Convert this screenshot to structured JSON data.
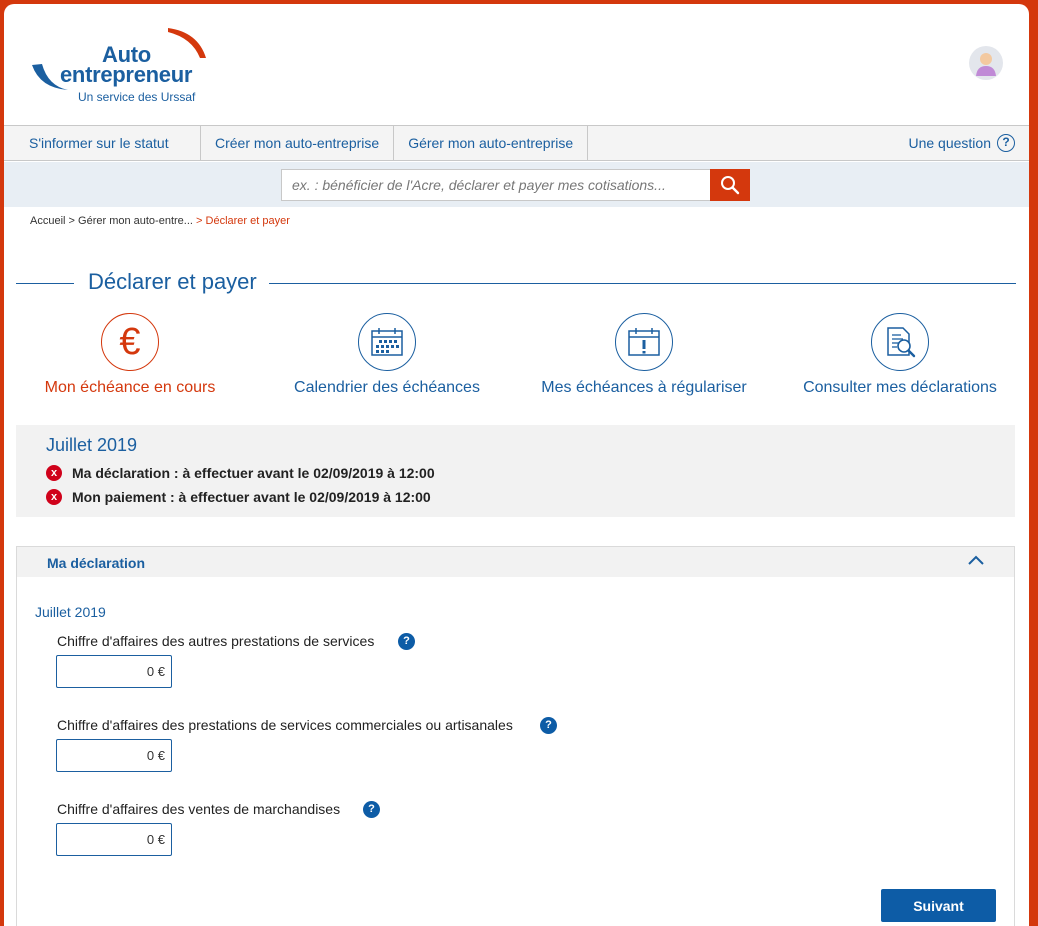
{
  "colors": {
    "brand_blue": "#1b5fa0",
    "accent_red": "#d4380d",
    "error_red": "#d0021b",
    "button_blue": "#0d5ca6"
  },
  "logo": {
    "line1": "Auto",
    "line2": "entrepreneur",
    "sub": "Un service des Urssaf"
  },
  "nav": {
    "items": [
      {
        "label": "S'informer sur le statut"
      },
      {
        "label": "Créer mon auto-entreprise"
      },
      {
        "label": "Gérer mon auto-entreprise"
      }
    ],
    "question_label": "Une question",
    "question_icon": "?"
  },
  "search": {
    "placeholder": "ex. : bénéficier de l'Acre, déclarer et payer mes cotisations..."
  },
  "breadcrumb": {
    "home": "Accueil",
    "sep1": " > ",
    "parent": "Gérer mon auto-entre...",
    "sep2": " > ",
    "current": "Déclarer et payer"
  },
  "page_title": "Déclarer et payer",
  "tiles": [
    {
      "label": "Mon échéance en cours",
      "icon": "euro-icon",
      "glyph": "€"
    },
    {
      "label": "Calendrier des échéances",
      "icon": "calendar-icon"
    },
    {
      "label": "Mes échéances à régulariser",
      "icon": "calendar-alert-icon"
    },
    {
      "label": "Consulter mes déclarations",
      "icon": "document-search-icon"
    }
  ],
  "summary": {
    "month": "Juillet 2019",
    "items": [
      {
        "text": "Ma déclaration : à effectuer avant le 02/09/2019 à 12:00",
        "icon": "x"
      },
      {
        "text": "Mon paiement : à effectuer avant le 02/09/2019 à 12:00",
        "icon": "x"
      }
    ]
  },
  "declaration": {
    "title": "Ma déclaration",
    "month": "Juillet 2019",
    "fields": [
      {
        "label": "Chiffre d'affaires des autres prestations de services",
        "value": "0 €",
        "help": "?"
      },
      {
        "label": "Chiffre d'affaires des prestations de services commerciales ou artisanales",
        "value": "0 €",
        "help": "?"
      },
      {
        "label": "Chiffre d'affaires des ventes de marchandises",
        "value": "0 €",
        "help": "?"
      }
    ],
    "next_label": "Suivant"
  }
}
